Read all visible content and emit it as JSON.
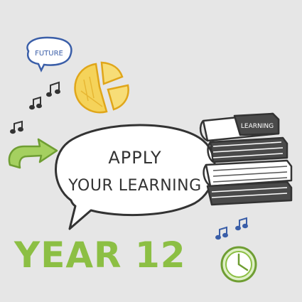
{
  "future_bubble": {
    "text": "FUTURE"
  },
  "main_bubble": {
    "line1": "APPLY",
    "line2": "YOUR LEARNING"
  },
  "book_spine": {
    "text": "LEARNING"
  },
  "title": {
    "text": "YEAR 12"
  },
  "icons": [
    "speech-bubble-icon",
    "pie-chart-icon",
    "music-notes-icon",
    "arrow-icon",
    "books-icon",
    "clock-icon"
  ],
  "colors": {
    "background": "#e6e6e6",
    "title_green": "#8cbf44",
    "pie_yellow": "#f2c12e",
    "future_blue": "#3a5ea8",
    "ink": "#333333",
    "arrow_green": "#8cbf44",
    "clock_green": "#8cbf44"
  }
}
